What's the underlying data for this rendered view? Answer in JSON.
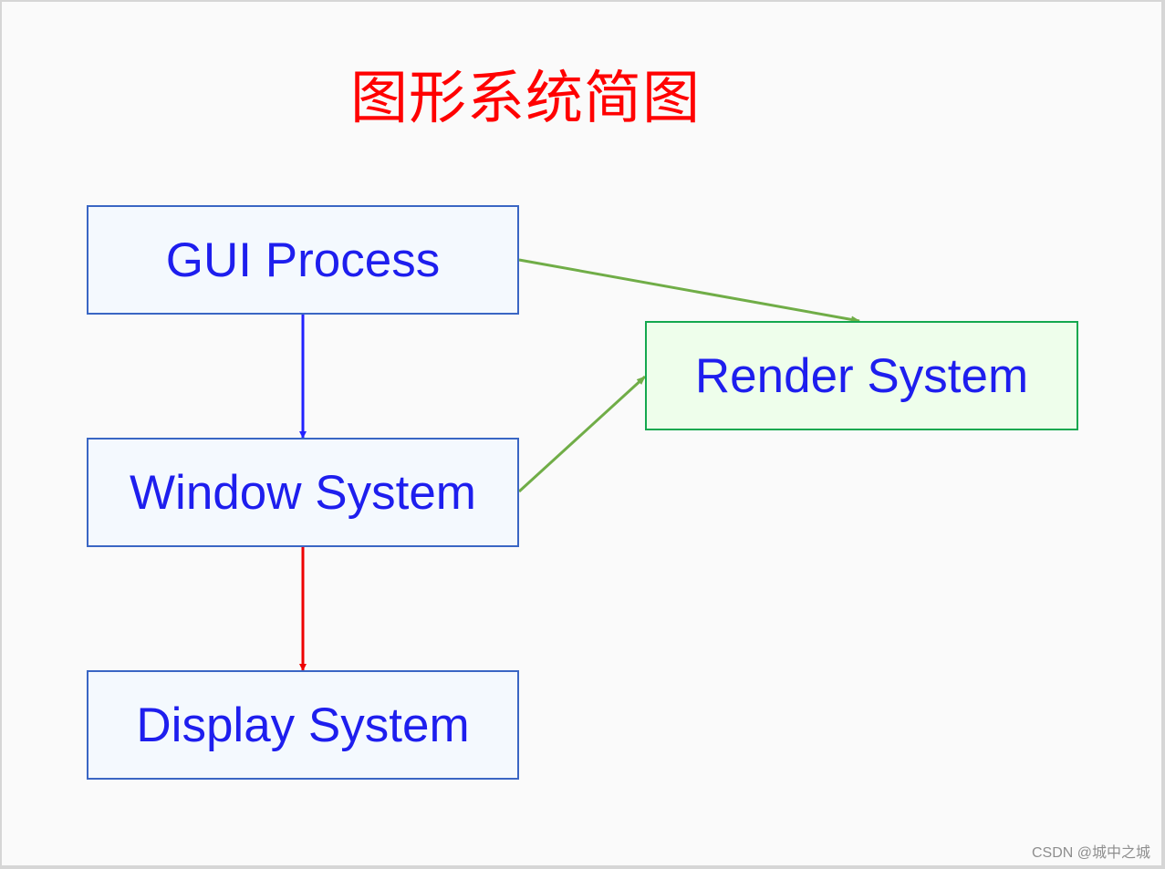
{
  "title": "图形系统简图",
  "colors": {
    "title": "#ff0000",
    "node_text": "#1e1eee",
    "node_border_blue": "#3a66c4",
    "node_fill_blue": "#f4f9fe",
    "node_border_green": "#14a84f",
    "node_fill_green": "#eefeeb",
    "edge_blue": "#2222ff",
    "edge_red": "#ee0000",
    "edge_green": "#70ad47"
  },
  "nodes": [
    {
      "id": "gui",
      "label": "GUI Process"
    },
    {
      "id": "window",
      "label": "Window System"
    },
    {
      "id": "display",
      "label": "Display System"
    },
    {
      "id": "render",
      "label": "Render System"
    }
  ],
  "edges": [
    {
      "from": "gui",
      "to": "window",
      "color": "blue"
    },
    {
      "from": "window",
      "to": "display",
      "color": "red"
    },
    {
      "from": "gui",
      "to": "render",
      "color": "green"
    },
    {
      "from": "window",
      "to": "render",
      "color": "green"
    }
  ],
  "watermark": "CSDN @城中之城"
}
